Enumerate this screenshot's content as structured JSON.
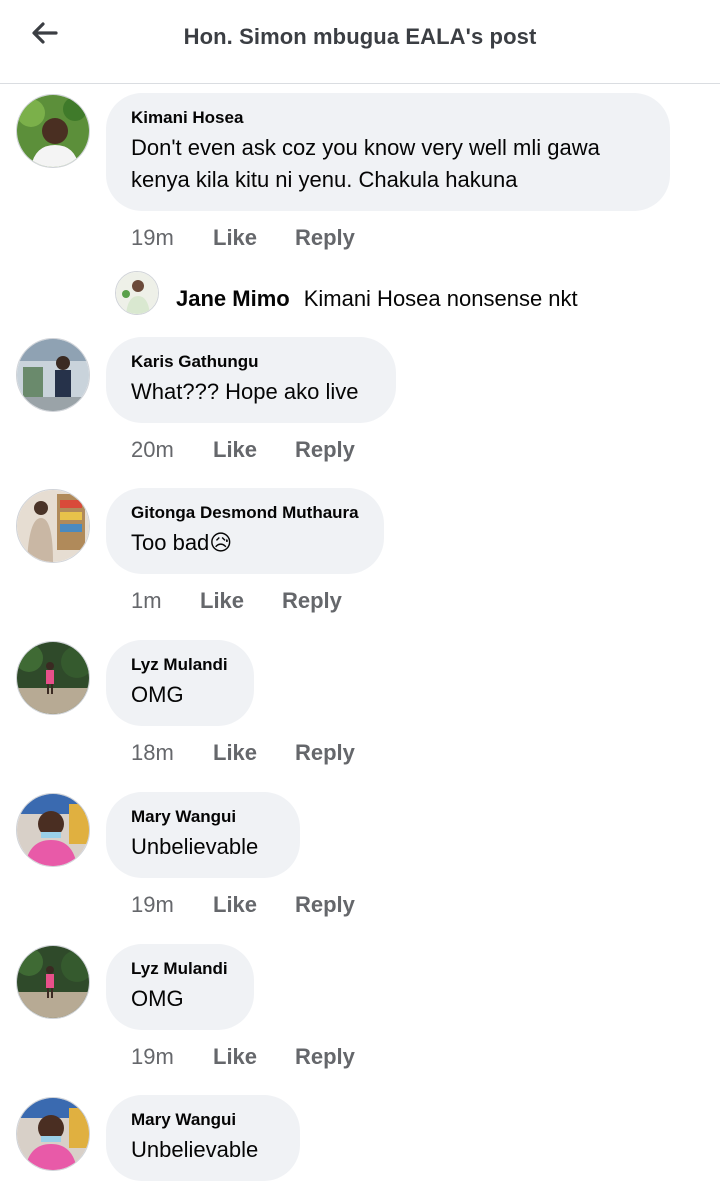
{
  "header": {
    "title": "Hon. Simon mbugua EALA's post"
  },
  "comments": [
    {
      "author": "Kimani Hosea",
      "text_line1": "Don't even ask coz you know very well  mli gawa",
      "text_line2": "kenya kila kitu ni yenu. Chakula hakuna",
      "time": "19m",
      "like": "Like",
      "reply": "Reply",
      "replies": [
        {
          "author": "Jane Mimo",
          "text": "Kimani Hosea nonsense nkt"
        }
      ]
    },
    {
      "author": "Karis Gathungu",
      "text": "What??? Hope ako live",
      "time": "20m",
      "like": "Like",
      "reply": "Reply"
    },
    {
      "author": "Gitonga Desmond Muthaura",
      "text": "Too bad",
      "emoji": "😥",
      "time": "1m",
      "like": "Like",
      "reply": "Reply"
    },
    {
      "author": "Lyz Mulandi",
      "text": "OMG",
      "time": "18m",
      "like": "Like",
      "reply": "Reply"
    },
    {
      "author": "Mary Wangui",
      "text": "Unbelievable",
      "time": "19m",
      "like": "Like",
      "reply": "Reply"
    },
    {
      "author": "Lyz Mulandi",
      "text": "OMG",
      "time": "19m",
      "like": "Like",
      "reply": "Reply"
    },
    {
      "author": "Mary Wangui",
      "text": "Unbelievable"
    }
  ],
  "colors": {
    "bubble": "#f0f2f5",
    "secondary_text": "#65676b",
    "header_title": "#3b3e43"
  }
}
